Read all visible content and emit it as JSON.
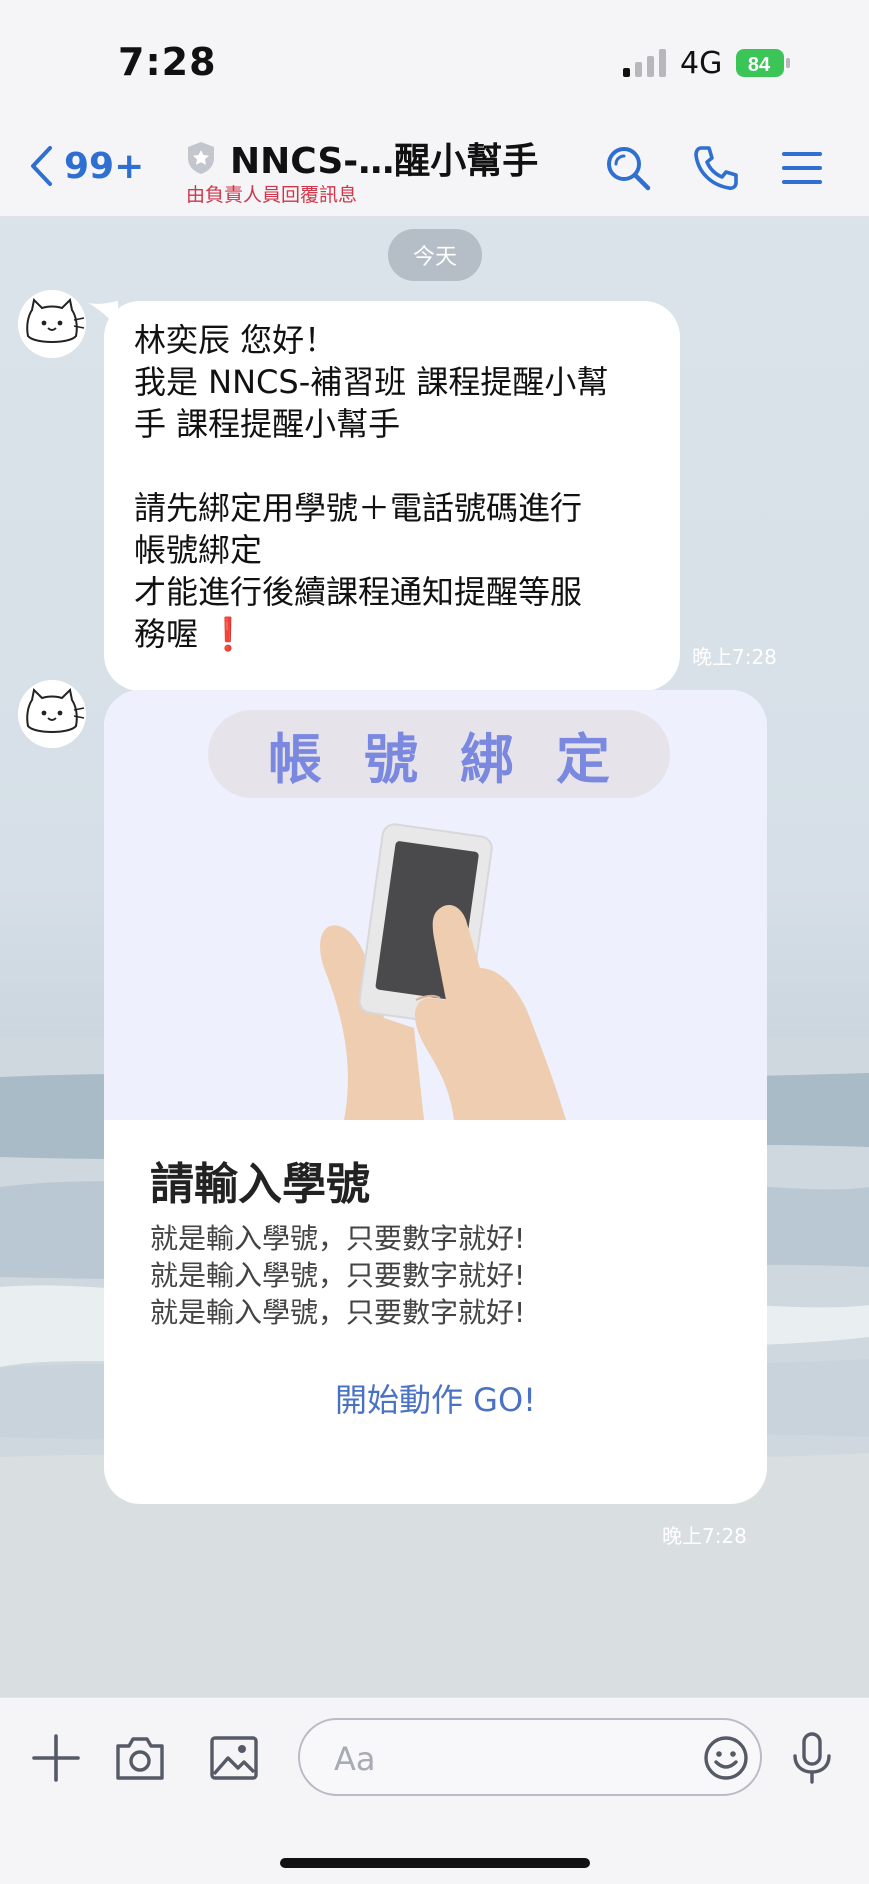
{
  "status_bar": {
    "time": "7:28",
    "network": "4G",
    "battery": "84"
  },
  "header": {
    "back_count": "99+",
    "title": "NNCS-…醒小幫手",
    "subtitle": "由負責人員回覆訊息"
  },
  "chat": {
    "date_label": "今天",
    "message1": {
      "lines": [
        "林奕辰 您好！",
        "我是 NNCS-補習班 課程提醒小幫",
        "手 課程提醒小幫手",
        "",
        "請先綁定用學號＋電話號碼進行",
        "帳號綁定",
        "才能進行後續課程通知提醒等服",
        "務喔"
      ],
      "emoji": "❗",
      "time": "晚上7:28"
    },
    "card": {
      "banner": "帳號綁定",
      "title": "請輸入學號",
      "desc_lines": [
        "就是輸入學號，只要數字就好!",
        "就是輸入學號，只要數字就好!",
        "就是輸入學號，只要數字就好!"
      ],
      "action": "開始動作 GO!",
      "time": "晚上7:28"
    }
  },
  "input": {
    "placeholder": "Aa"
  },
  "colors": {
    "accent": "#2f6fd1",
    "subtitle": "#d0364a",
    "banner_text": "#7a88e0",
    "card_hero_bg": "#eef0fe"
  },
  "icons": [
    "back-chevron-icon",
    "official-badge-icon",
    "search-icon",
    "phone-icon",
    "menu-icon",
    "plus-icon",
    "camera-icon",
    "image-icon",
    "emoji-icon",
    "microphone-icon"
  ]
}
